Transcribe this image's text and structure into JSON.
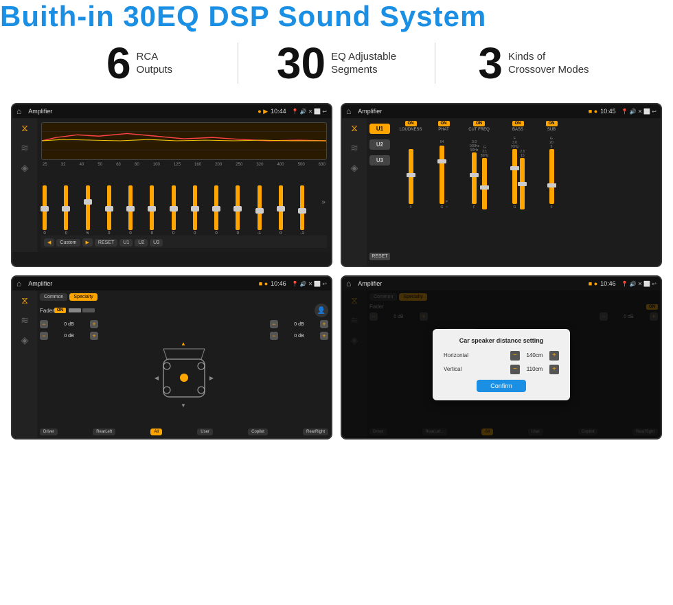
{
  "header": {
    "title": "Buith-in 30EQ DSP Sound System"
  },
  "stats": [
    {
      "number": "6",
      "text_line1": "RCA",
      "text_line2": "Outputs"
    },
    {
      "number": "30",
      "text_line1": "EQ Adjustable",
      "text_line2": "Segments"
    },
    {
      "number": "3",
      "text_line1": "Kinds of",
      "text_line2": "Crossover Modes"
    }
  ],
  "screens": [
    {
      "id": "eq-screen",
      "status": {
        "app": "Amplifier",
        "dots": "● ▶",
        "time": "10:44"
      },
      "type": "eq",
      "eq_labels": [
        "25",
        "32",
        "40",
        "50",
        "63",
        "80",
        "100",
        "125",
        "160",
        "200",
        "250",
        "320",
        "400",
        "500",
        "630"
      ],
      "preset": "Custom",
      "buttons": [
        "◀",
        "Custom",
        "▶",
        "RESET",
        "U1",
        "U2",
        "U3"
      ]
    },
    {
      "id": "crossover-screen",
      "status": {
        "app": "Amplifier",
        "dots": "■ ●",
        "time": "10:45"
      },
      "type": "crossover",
      "presets": [
        "U1",
        "U2",
        "U3"
      ],
      "channels": [
        {
          "label": "LOUDNESS",
          "on": true
        },
        {
          "label": "PHAT",
          "on": true
        },
        {
          "label": "CUT FREQ",
          "on": true
        },
        {
          "label": "BASS",
          "on": true
        },
        {
          "label": "SUB",
          "on": true
        }
      ]
    },
    {
      "id": "fader-screen",
      "status": {
        "app": "Amplifier",
        "dots": "■ ●",
        "time": "10:46"
      },
      "type": "fader",
      "tabs": [
        "Common",
        "Specialty"
      ],
      "active_tab": "Specialty",
      "fader_label": "Fader",
      "fader_on": true,
      "left_values": [
        "0 dB",
        "0 dB"
      ],
      "right_values": [
        "0 dB",
        "0 dB"
      ],
      "bottom_buttons": [
        "Driver",
        "RearLeft",
        "All",
        "User",
        "Copilot",
        "RearRight"
      ]
    },
    {
      "id": "dialog-screen",
      "status": {
        "app": "Amplifier",
        "dots": "■ ●",
        "time": "10:46"
      },
      "type": "dialog",
      "dialog": {
        "title": "Car speaker distance setting",
        "horizontal_label": "Horizontal",
        "horizontal_value": "140cm",
        "vertical_label": "Vertical",
        "vertical_value": "110cm",
        "confirm_label": "Confirm"
      },
      "tabs": [
        "Common",
        "Specialty"
      ],
      "active_tab": "Specialty",
      "left_values": [
        "0 dB"
      ],
      "right_values": [
        "0 dB"
      ],
      "bottom_buttons": [
        "Driver",
        "RearLef...",
        "User",
        "Copilot",
        "RearRight"
      ]
    }
  ]
}
